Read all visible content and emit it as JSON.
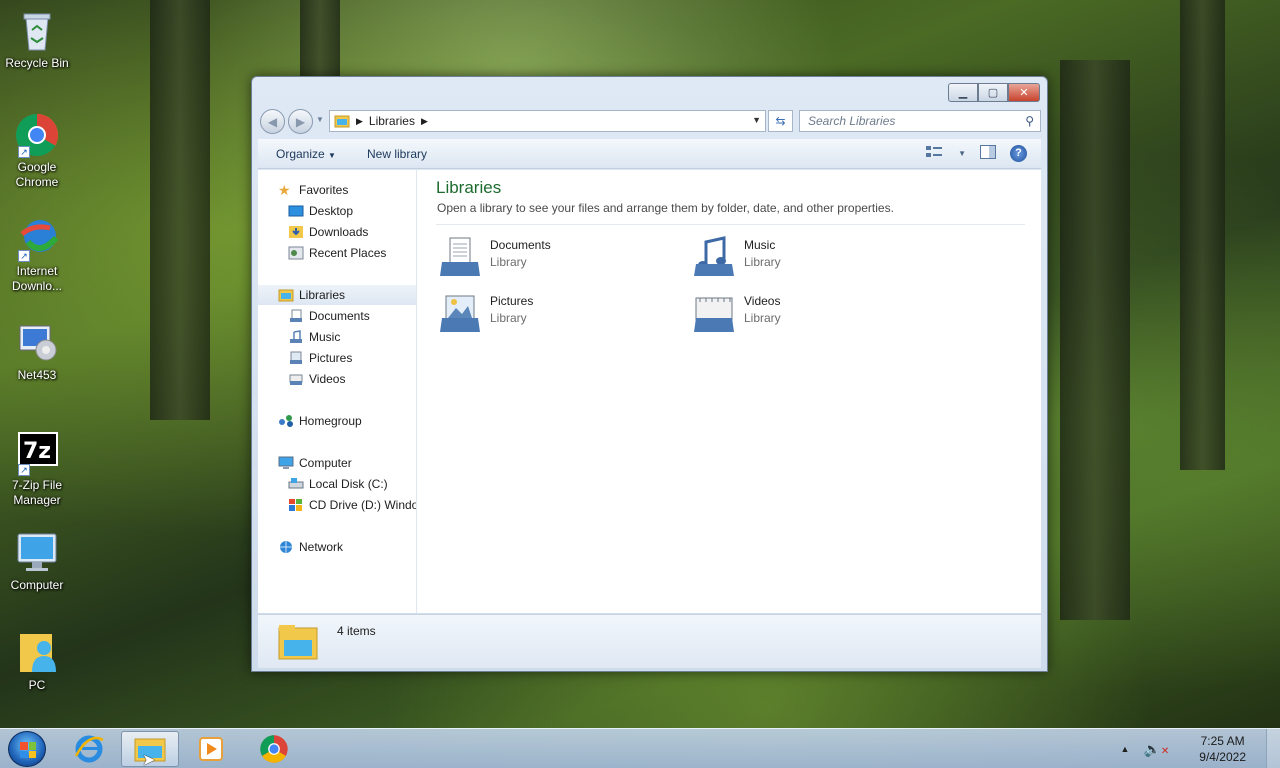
{
  "desktop": {
    "icons": [
      {
        "label": "Recycle Bin"
      },
      {
        "label": "Google Chrome"
      },
      {
        "label": "Internet Downlo..."
      },
      {
        "label": "Net453"
      },
      {
        "label": "7-Zip File Manager"
      },
      {
        "label": "Computer"
      },
      {
        "label": "PC"
      }
    ]
  },
  "window": {
    "address": {
      "segment": "Libraries"
    },
    "search": {
      "placeholder": "Search Libraries"
    },
    "toolbar": {
      "organize": "Organize",
      "new_library": "New library"
    },
    "nav": {
      "favorites": "Favorites",
      "desktop": "Desktop",
      "downloads": "Downloads",
      "recent": "Recent Places",
      "libraries": "Libraries",
      "documents": "Documents",
      "music": "Music",
      "pictures": "Pictures",
      "videos": "Videos",
      "homegroup": "Homegroup",
      "computer": "Computer",
      "local_disk": "Local Disk (C:)",
      "cd_drive": "CD Drive (D:) Windo",
      "network": "Network"
    },
    "content": {
      "title": "Libraries",
      "subtitle": "Open a library to see your files and arrange them by folder, date, and other properties.",
      "libraries": [
        {
          "name": "Documents",
          "type": "Library"
        },
        {
          "name": "Music",
          "type": "Library"
        },
        {
          "name": "Pictures",
          "type": "Library"
        },
        {
          "name": "Videos",
          "type": "Library"
        }
      ]
    },
    "status": {
      "count": "4 items"
    }
  },
  "taskbar": {
    "clock": {
      "time": "7:25 AM",
      "date": "9/4/2022"
    }
  },
  "colors": {
    "title_green": "#1e6b2f",
    "accent_blue": "#1e395b",
    "close_red": "#c7432d"
  }
}
